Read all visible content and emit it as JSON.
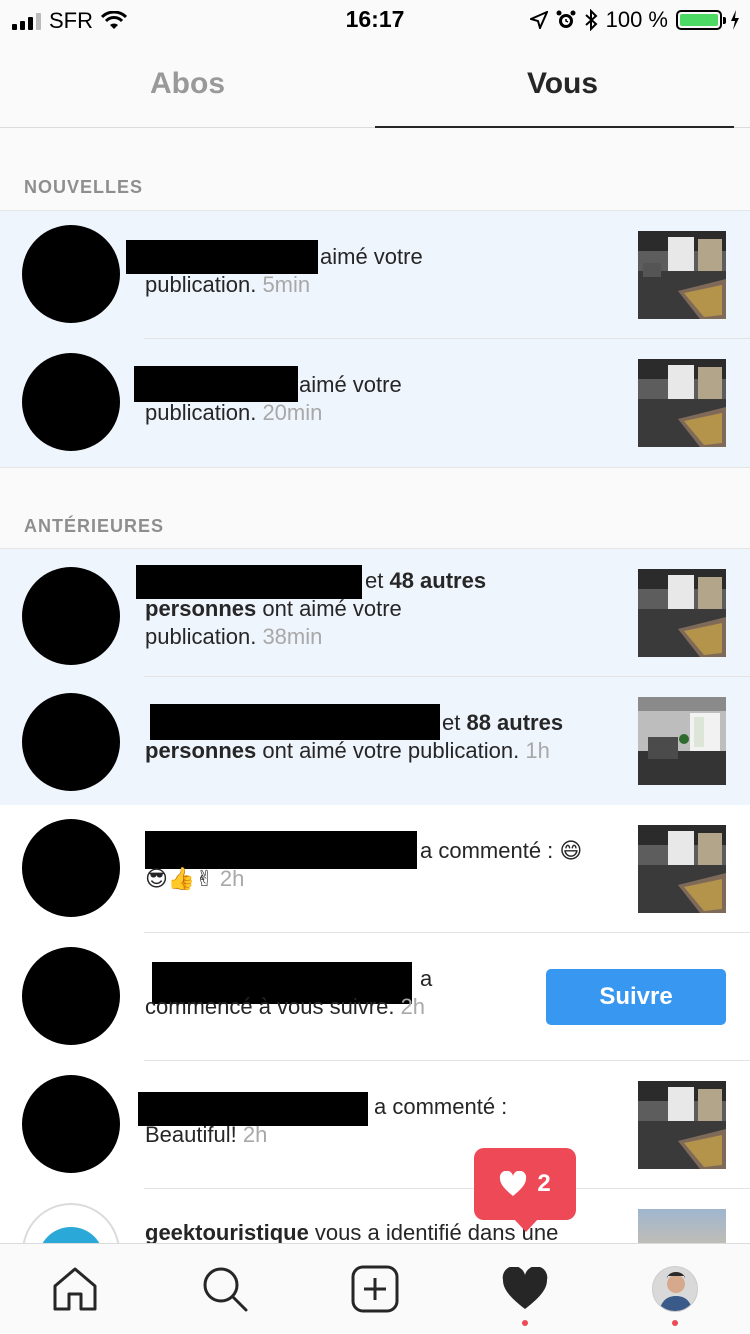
{
  "status": {
    "carrier": "SFR",
    "time": "16:17",
    "battery": "100 %"
  },
  "tabs": [
    {
      "label": "Abos"
    },
    {
      "label": "Vous"
    }
  ],
  "sections": [
    {
      "label": "NOUVELLES"
    },
    {
      "label": "ANTÉRIEURES"
    }
  ],
  "rows": [
    {
      "text": "aimé votre",
      "text2": "publication.",
      "time": "5min"
    },
    {
      "text": "aimé votre",
      "text2": "publication.",
      "time": "20min"
    },
    {
      "mid": " et ",
      "bold1": "48 autres",
      "bold2": "personnes",
      "text": " ont aimé votre",
      "text2": "publication.",
      "time": "38min"
    },
    {
      "mid": "et ",
      "bold1": "88 autres",
      "bold2": "personnes",
      "text": " ont aimé votre publication.",
      "time": "1h"
    },
    {
      "text": "a commenté :",
      "emoji1": "😄",
      "emoji2": "😎👍✌",
      "time": "2h"
    },
    {
      "text": "a",
      "text2": "commencé à vous suivre.",
      "time": "2h",
      "button": "Suivre"
    },
    {
      "text": "a commenté :",
      "text2": "Beautiful!",
      "time": "2h"
    },
    {
      "user": "geektouristique",
      "text": " vous a identifié dans une"
    }
  ],
  "notification": {
    "count": "2"
  },
  "nav": [
    {
      "icon": "home-icon"
    },
    {
      "icon": "search-icon"
    },
    {
      "icon": "add-icon"
    },
    {
      "icon": "heart-icon"
    },
    {
      "icon": "profile-avatar"
    }
  ],
  "colors": {
    "accent": "#3897f0",
    "badge": "#ed4956",
    "highlight": "#eff5fd"
  }
}
